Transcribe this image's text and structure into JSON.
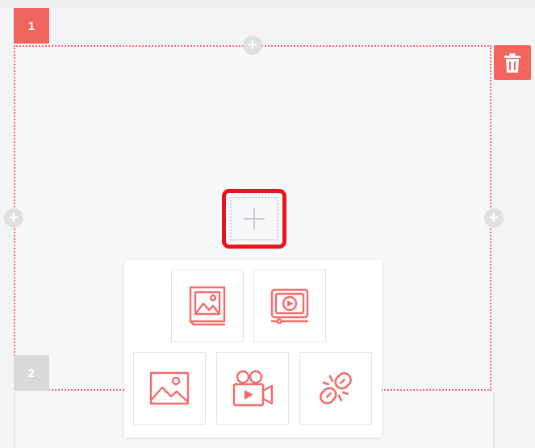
{
  "blocks": [
    {
      "badge": "1",
      "state": "selected"
    },
    {
      "badge": "2",
      "state": "idle"
    }
  ],
  "colors": {
    "accent": "#f0645e",
    "highlight": "#e8141b",
    "icon": "#f26b6b",
    "inactive_badge": "#d8d9db"
  },
  "icons": {
    "delete": "trash-icon",
    "add": "plus-icon",
    "handles": "plus-circle-icon"
  },
  "element_picker": {
    "options": [
      {
        "icon": "gallery-icon"
      },
      {
        "icon": "video-slider-icon"
      },
      {
        "icon": "image-icon"
      },
      {
        "icon": "video-camera-icon"
      },
      {
        "icon": "broken-link-icon"
      }
    ]
  }
}
